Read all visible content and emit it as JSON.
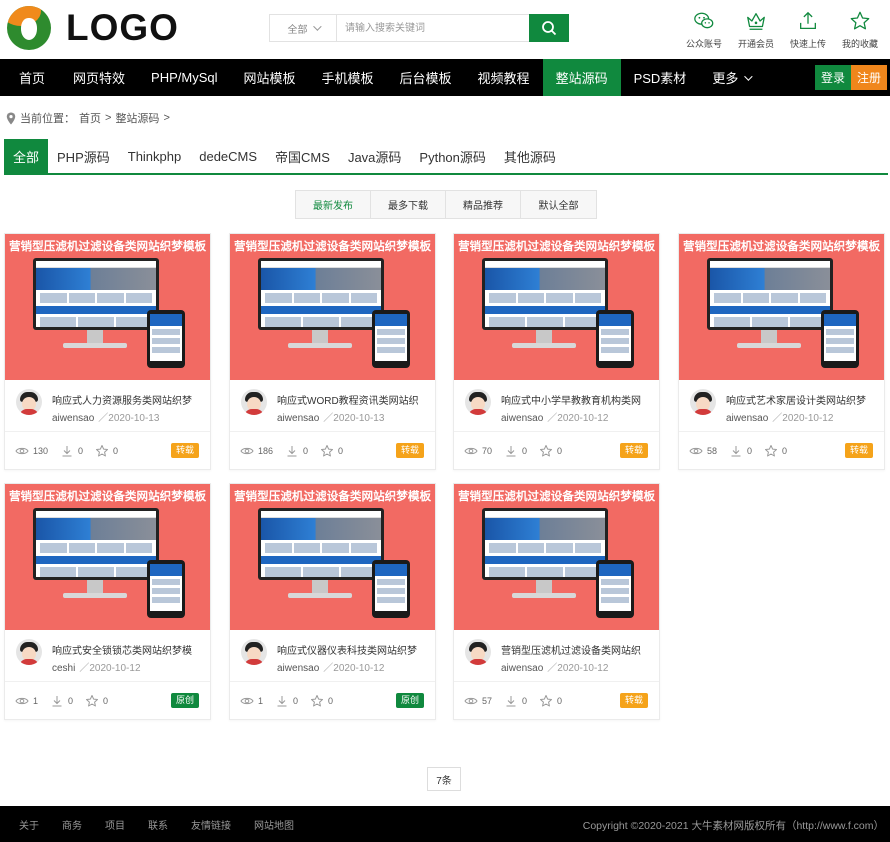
{
  "header": {
    "logo_text": "LOGO",
    "search": {
      "category": "全部",
      "placeholder": "请输入搜索关键词"
    },
    "quick_links": [
      {
        "label": "公众账号",
        "icon": "wechat-icon"
      },
      {
        "label": "开通会员",
        "icon": "crown-icon"
      },
      {
        "label": "快速上传",
        "icon": "upload-icon"
      },
      {
        "label": "我的收藏",
        "icon": "star-icon"
      }
    ]
  },
  "nav": {
    "items": [
      "首页",
      "网页特效",
      "PHP/MySql",
      "网站模板",
      "手机模板",
      "后台模板",
      "视频教程",
      "整站源码",
      "PSD素材"
    ],
    "active_index": 7,
    "more_label": "更多",
    "login_label": "登录",
    "register_label": "注册"
  },
  "breadcrumb": {
    "prefix": "当前位置：",
    "home": "首页",
    "sep": ">",
    "current": "整站源码",
    "trail": ">"
  },
  "categories": {
    "items": [
      "全部",
      "PHP源码",
      "Thinkphp",
      "dedeCMS",
      "帝国CMS",
      "Java源码",
      "Python源码",
      "其他源码"
    ],
    "active_index": 0
  },
  "sort": {
    "items": [
      "最新发布",
      "最多下载",
      "精品推荐",
      "默认全部"
    ],
    "active_index": 0
  },
  "cards": [
    {
      "thumb_title": "营销型压滤机过滤设备类网站织梦模板",
      "title": "响应式人力资源服务类网站织梦",
      "author": "aiwensao",
      "date": "／2020-10-13",
      "views": "130",
      "downloads": "0",
      "favorites": "0",
      "badge": "转载",
      "badge_color": "#f5a31a"
    },
    {
      "thumb_title": "营销型压滤机过滤设备类网站织梦模板",
      "title": "响应式WORD教程资讯类网站织",
      "author": "aiwensao",
      "date": "／2020-10-13",
      "views": "186",
      "downloads": "0",
      "favorites": "0",
      "badge": "转载",
      "badge_color": "#f5a31a"
    },
    {
      "thumb_title": "营销型压滤机过滤设备类网站织梦模板",
      "title": "响应式中小学早教教育机构类网",
      "author": "aiwensao",
      "date": "／2020-10-12",
      "views": "70",
      "downloads": "0",
      "favorites": "0",
      "badge": "转载",
      "badge_color": "#f5a31a"
    },
    {
      "thumb_title": "营销型压滤机过滤设备类网站织梦模板",
      "title": "响应式艺术家居设计类网站织梦",
      "author": "aiwensao",
      "date": "／2020-10-12",
      "views": "58",
      "downloads": "0",
      "favorites": "0",
      "badge": "转载",
      "badge_color": "#f5a31a"
    },
    {
      "thumb_title": "营销型压滤机过滤设备类网站织梦模板",
      "title": "响应式安全锁锁芯类网站织梦模",
      "author": "ceshi",
      "date": "／2020-10-12",
      "views": "1",
      "downloads": "0",
      "favorites": "0",
      "badge": "原创",
      "badge_color": "#10893e"
    },
    {
      "thumb_title": "营销型压滤机过滤设备类网站织梦模板",
      "title": "响应式仪器仪表科技类网站织梦",
      "author": "aiwensao",
      "date": "／2020-10-12",
      "views": "1",
      "downloads": "0",
      "favorites": "0",
      "badge": "原创",
      "badge_color": "#10893e"
    },
    {
      "thumb_title": "营销型压滤机过滤设备类网站织梦模板",
      "title": "营销型压滤机过滤设备类网站织",
      "author": "aiwensao",
      "date": "／2020-10-12",
      "views": "57",
      "downloads": "0",
      "favorites": "0",
      "badge": "转载",
      "badge_color": "#f5a31a"
    }
  ],
  "pager": {
    "total": "7条"
  },
  "footer": {
    "links": [
      "关于",
      "商务",
      "项目",
      "联系",
      "友情链接",
      "网站地图"
    ],
    "copyright": "Copyright ©2020-2021 大牛素材网版权所有（http://www.f.com）"
  },
  "colors": {
    "brand_green": "#10893e",
    "accent_orange": "#f0861c",
    "thumb_red": "#f26a63",
    "nav_bg": "#000000"
  }
}
